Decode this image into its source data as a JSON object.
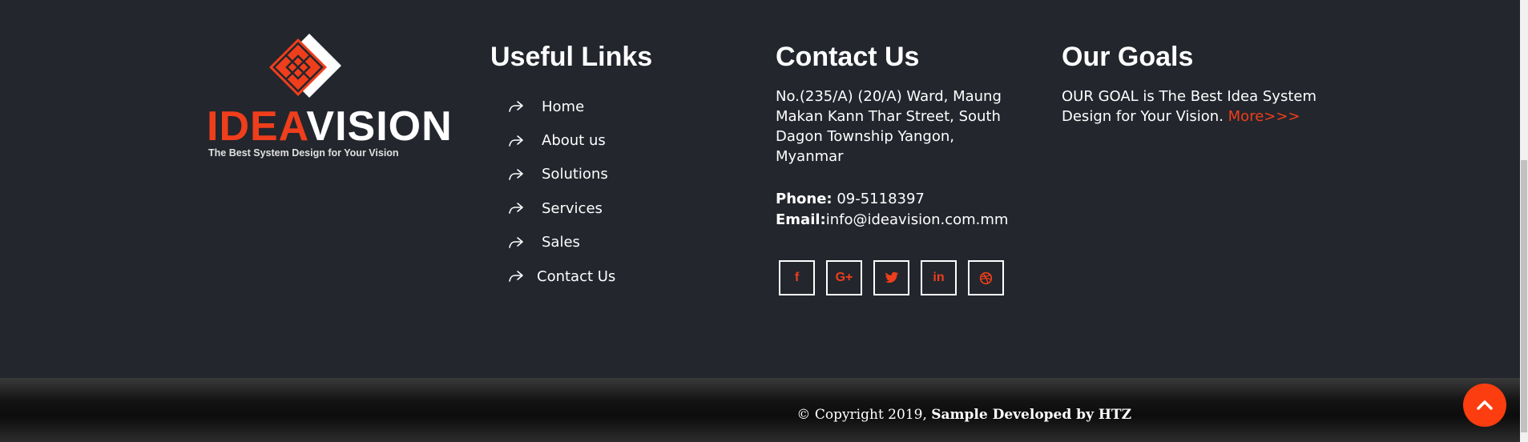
{
  "logo": {
    "word_part1": "IDEA",
    "word_part2": "VISION",
    "tagline": "The Best System Design for Your Vision",
    "brand_color": "#ef3e1c"
  },
  "useful_links": {
    "title": "Useful Links",
    "items": [
      {
        "label": "Home",
        "icon": "share-arrow-icon"
      },
      {
        "label": "About us",
        "icon": "share-arrow-icon"
      },
      {
        "label": "Solutions",
        "icon": "share-arrow-icon"
      },
      {
        "label": "Services",
        "icon": "share-arrow-icon"
      },
      {
        "label": "Sales",
        "icon": "share-arrow-icon"
      },
      {
        "label": "Contact Us",
        "icon": "share-arrow-icon"
      }
    ]
  },
  "contact": {
    "title": "Contact Us",
    "address": "No.(235/A) (20/A) Ward, Maung Makan Kann Thar Street, South Dagon Township Yangon, Myanmar",
    "phone_label": "Phone:",
    "phone_value": " 09-5118397",
    "email_label": "Email:",
    "email_value": "info@ideavision.com.mm",
    "social": [
      {
        "name": "facebook-icon",
        "glyph": "f"
      },
      {
        "name": "google-plus-icon",
        "glyph": "G+"
      },
      {
        "name": "twitter-icon",
        "glyph": "t"
      },
      {
        "name": "linkedin-icon",
        "glyph": "in"
      },
      {
        "name": "dribbble-icon",
        "glyph": "◎"
      }
    ]
  },
  "goals": {
    "title": "Our Goals",
    "text": "OUR GOAL is The Best Idea System Design for Your Vision. ",
    "more_label": "More>>>"
  },
  "copyright": {
    "prefix": "© Copyright 2019, ",
    "bold": "Sample Developed by HTZ"
  },
  "back_to_top": {
    "icon": "chevron-up-icon",
    "color": "#fb3d10"
  }
}
